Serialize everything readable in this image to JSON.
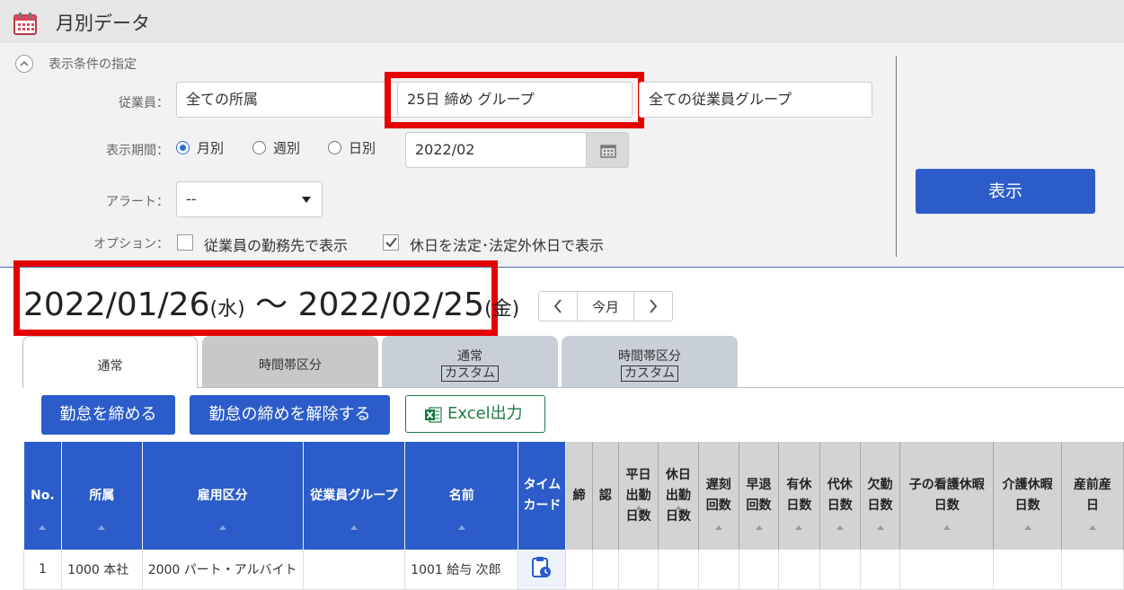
{
  "header": {
    "title": "月別データ",
    "icon": "calendar-icon"
  },
  "conditions": {
    "section_title": "表示条件の指定",
    "employee_label": "従業員：",
    "affiliation_value": "全ての所属",
    "closing_group_value": "25日 締め グループ",
    "employee_group_value": "全ての従業員グループ",
    "period_label": "表示期間：",
    "period_options": [
      {
        "label": "月別",
        "selected": true
      },
      {
        "label": "週別",
        "selected": false
      },
      {
        "label": "日別",
        "selected": false
      }
    ],
    "month_value": "2022/02",
    "alert_label": "アラート：",
    "alert_value": "--",
    "option_label": "オプション：",
    "option_workplace": {
      "label": "従業員の勤務先で表示",
      "checked": false
    },
    "option_holiday": {
      "label": "休日を法定･法定外休日で表示",
      "checked": true
    },
    "show_button": "表示"
  },
  "period": {
    "start": "2022/01/26",
    "start_dow": "(水)",
    "tilde": "～",
    "end": "2022/02/25",
    "end_dow": "(金)"
  },
  "pager": {
    "prev": "‹",
    "today": "今月",
    "next": "›"
  },
  "tabs": [
    {
      "line1": "通常",
      "line2": ""
    },
    {
      "line1": "時間帯区分",
      "line2": ""
    },
    {
      "line1": "通常",
      "line2": "カスタム"
    },
    {
      "line1": "時間帯区分",
      "line2": "カスタム"
    }
  ],
  "actions": {
    "close_attendance": "勤怠を締める",
    "release_close": "勤怠の締めを解除する",
    "excel_export": "Excel出力"
  },
  "table": {
    "headers": [
      "No.",
      "所属",
      "雇用区分",
      "従業員グループ",
      "名前",
      "タイム\nカード",
      "締",
      "認",
      "平日\n出勤\n日数",
      "休日\n出勤\n日数",
      "遅刻\n回数",
      "早退\n回数",
      "有休\n日数",
      "代休\n日数",
      "欠勤\n日数",
      "子の看護休暇\n日数",
      "介護休暇\n日数",
      "産前産\n日"
    ],
    "rows": [
      {
        "no": "1",
        "affiliation": "1000 本社",
        "employment": "2000 パート・アルバイト",
        "group": "",
        "name": "1001 給与 次郎"
      }
    ]
  },
  "colors": {
    "accent": "#2b5cc9",
    "highlight": "#e60000",
    "excel": "#1d7a44"
  }
}
